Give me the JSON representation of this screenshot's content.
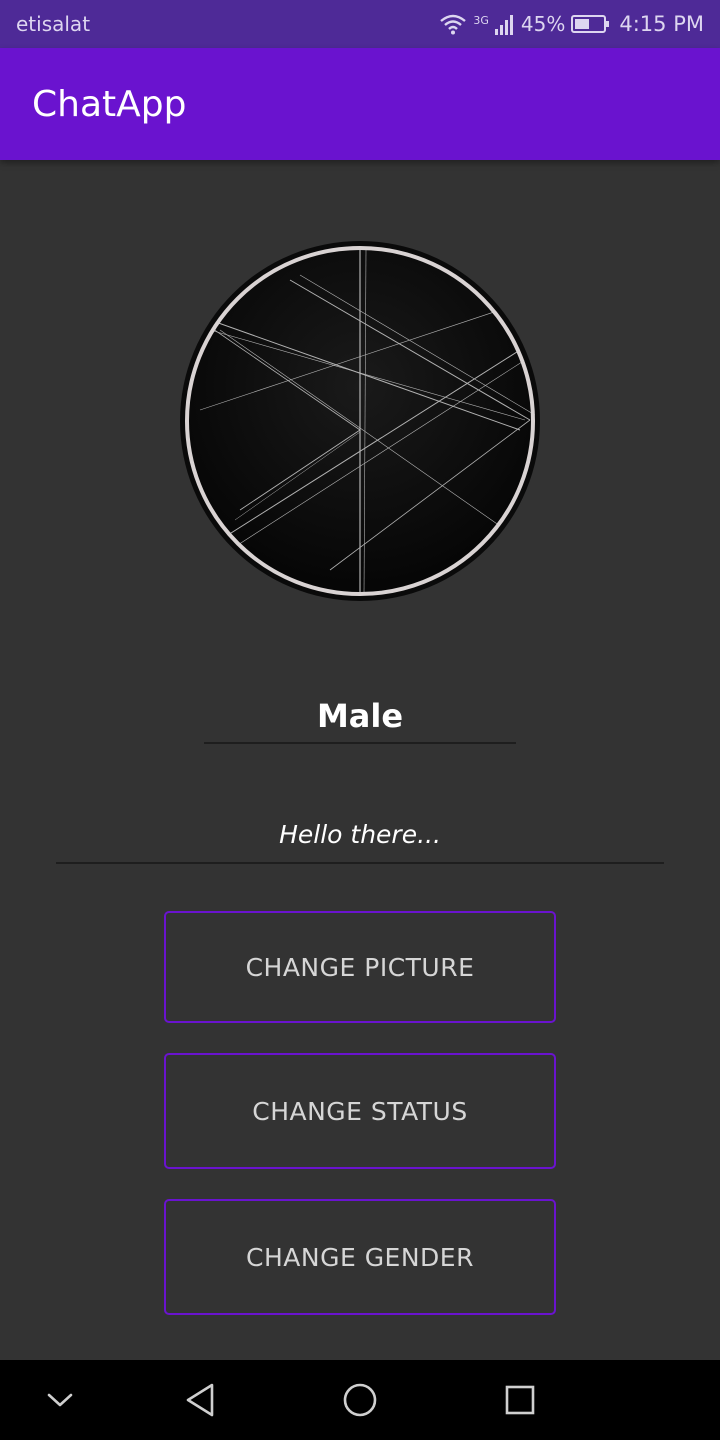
{
  "status_bar": {
    "carrier": "etisalat",
    "network_type": "3G",
    "battery_percent": "45%",
    "time": "4:15 PM",
    "icons": [
      "wifi-icon",
      "signal-icon",
      "battery-icon"
    ]
  },
  "app_bar": {
    "title": "ChatApp"
  },
  "profile": {
    "avatar_icon": "profile-image",
    "gender": "Male",
    "status": "Hello there..."
  },
  "actions": {
    "change_picture": "CHANGE PICTURE",
    "change_status": "CHANGE STATUS",
    "change_gender": "CHANGE GENDER"
  },
  "nav_bar": {
    "icons": [
      "chevron-down-icon",
      "back-icon",
      "home-icon",
      "recents-icon"
    ]
  },
  "colors": {
    "primary": "#6a13cf",
    "status_bar": "#4e2a97",
    "background": "#333333"
  }
}
